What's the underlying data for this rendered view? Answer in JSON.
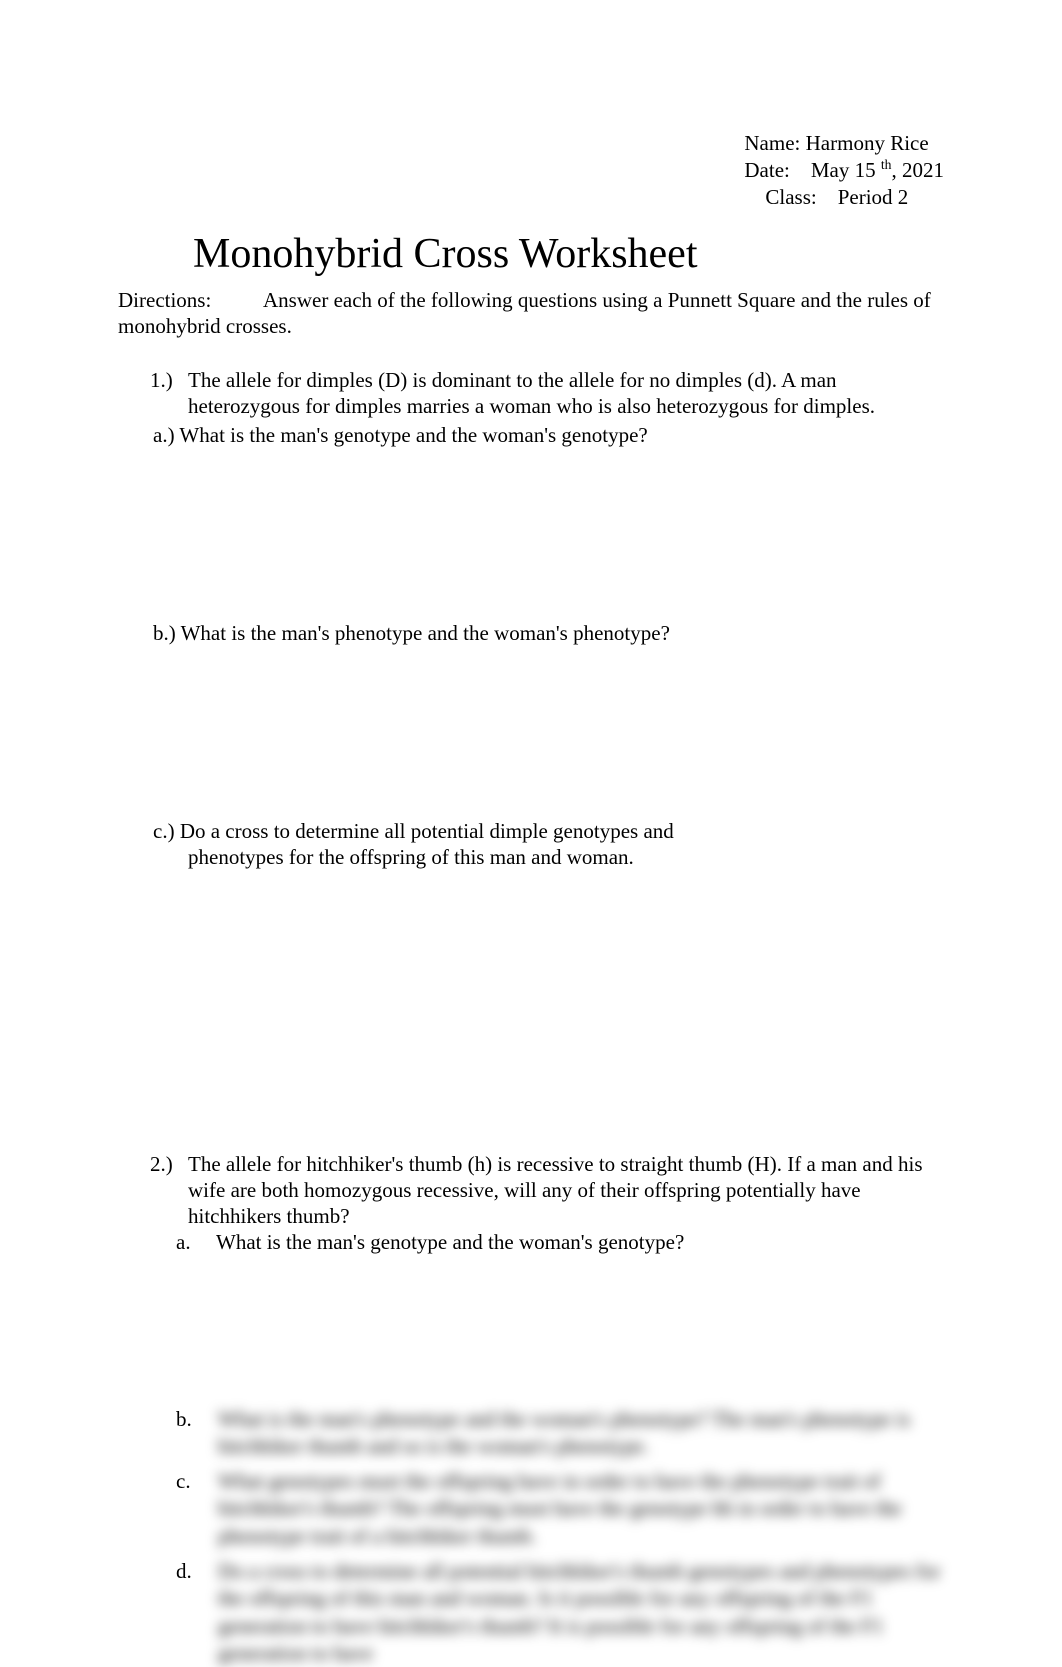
{
  "header": {
    "name_label": "Name:",
    "name_value": "Harmony Rice",
    "date_label": "Date:",
    "date_month_day": "May 15",
    "date_th": "th",
    "date_year": ", 2021",
    "class_label": "Class:",
    "class_value": "Period 2"
  },
  "title": "Monohybrid Cross Worksheet",
  "directions": {
    "label": "Directions:",
    "text": "Answer each of the following questions using a Punnett Square and the rules of monohybrid crosses."
  },
  "q1": {
    "num": "1.)",
    "prompt": "The allele for dimples (D) is dominant to the allele for no dimples (d). A man heterozygous for dimples marries a woman who is also heterozygous for dimples.",
    "a": "a.) What is the man's genotype and the woman's genotype?",
    "b": "b.) What is the man's phenotype and the woman's phenotype?",
    "c_line1": "c.) Do a cross to determine all potential dimple genotypes and",
    "c_line2": "phenotypes for the offspring of this man and woman."
  },
  "q2": {
    "num": "2.)",
    "prompt": "The allele for hitchhiker's thumb (h) is recessive to straight thumb (H). If a man and his wife are both homozygous recessive, will any of their offspring potentially have hitchhikers thumb?",
    "a_label": "a.",
    "a_text": "What is the man's genotype and the woman's genotype?",
    "b_label": "b.",
    "c_label": "c.",
    "d_label": "d."
  },
  "blurred": {
    "b_text": "What is the man's phenotype and the woman's phenotype? The man's phenotype is hitchhiker thumb and so is the woman's phenotype.",
    "c_text": "What genotypes must the offspring have in order to have the phenotype trait of hitchhiker's thumb? The offspring must have the genotype hh in order to have the phenotype trait of a hitchhiker thumb.",
    "d_text": "Do a cross to determine all potential hitchhiker's thumb genotypes and phenotypes for the offspring of this man and woman. Is it possible for any offspring of the F1 generation to have hitchhiker's thumb? It is possible for any offspring of the F1 generation to have"
  }
}
